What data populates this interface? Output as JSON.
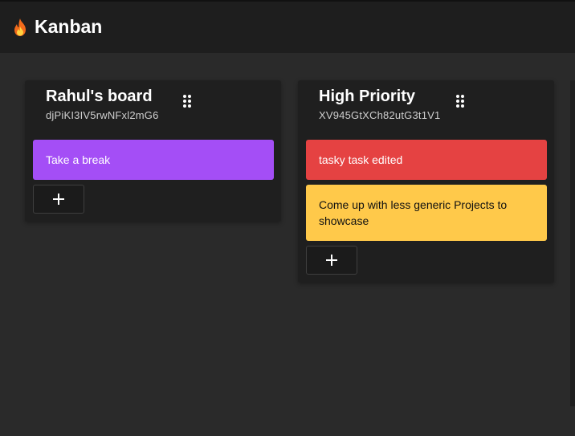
{
  "app": {
    "title": "Kanban",
    "logo_icon": "flame-icon"
  },
  "colors": {
    "header_bg": "#1e1e1e",
    "board_bg": "#2a2a2a",
    "column_bg": "#1f1f1f",
    "purple": "#a44ef6",
    "red": "#e54242",
    "yellow": "#ffc94a"
  },
  "columns": [
    {
      "title": "Rahul's board",
      "id_text": "djPiKI3IV5rwNFxl2mG6",
      "cards": [
        {
          "text": "Take a break",
          "color": "#a44ef6",
          "text_color": "#ffffff"
        }
      ],
      "add_icon": "plus-icon"
    },
    {
      "title": "High Priority",
      "id_text": "XV945GtXCh82utG3t1V1",
      "cards": [
        {
          "text": "tasky task edited",
          "color": "#e54242",
          "text_color": "#ffffff"
        },
        {
          "text": "Come up with less generic Projects to showcase",
          "color": "#ffc94a",
          "text_color": "#111111"
        }
      ],
      "add_icon": "plus-icon"
    }
  ]
}
